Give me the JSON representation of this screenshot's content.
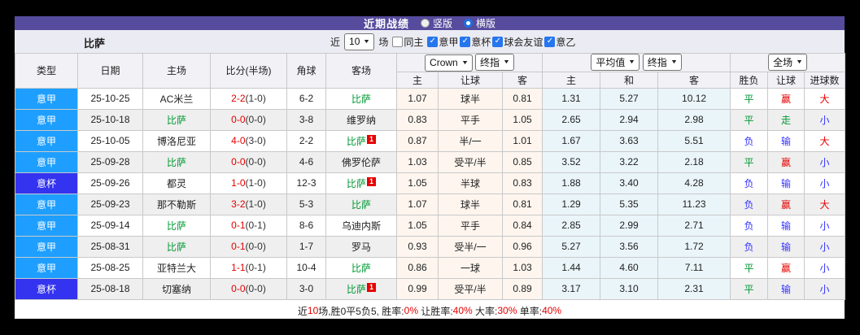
{
  "colors": {
    "header_purple": "#564c9d",
    "filter_bg": "#ebebf3",
    "header_bg": "#f1f1f6",
    "league_a": "#1e9fff",
    "league_b": "#3333f0",
    "win_red": "#e60000",
    "lose_blue": "#3333ff",
    "draw_green": "#009933",
    "check_blue": "#2676ee",
    "cream_bg": "#fdf5ee",
    "ltblue_bg": "#eaf5fa"
  },
  "title_bar": {
    "title": "近期战绩",
    "radio_vertical": "竖版",
    "radio_horizontal": "横版"
  },
  "filter_bar": {
    "team": "比萨",
    "recent_label": "近",
    "recent_count": "10",
    "games_label": "场",
    "same_home_label": "同主",
    "leagues": [
      "意甲",
      "意杯",
      "球会友谊",
      "意乙"
    ]
  },
  "table": {
    "headers": {
      "type": "类型",
      "date": "日期",
      "home": "主场",
      "score": "比分(半场)",
      "corner": "角球",
      "away": "客场",
      "crown_bookmaker": "Crown",
      "crown_stage": "终指",
      "crown_home": "主",
      "crown_line": "让球",
      "crown_away": "客",
      "avg_bookmaker": "平均值",
      "avg_stage": "终指",
      "avg_home": "主",
      "avg_draw": "和",
      "avg_away": "客",
      "result_scope": "全场",
      "win_loss": "胜负",
      "handicap": "让球",
      "goals": "进球数"
    },
    "rows": [
      {
        "league": "意甲",
        "league_class": "la",
        "date": "25-10-25",
        "home": "AC米兰",
        "home_is_focus": false,
        "score_ft": "2-2",
        "score_ht": "(1-0)",
        "corner": "6-2",
        "away": "比萨",
        "away_is_focus": true,
        "away_red_card": false,
        "crown": [
          "1.07",
          "球半",
          "0.81"
        ],
        "avg": [
          "1.31",
          "5.27",
          "10.12"
        ],
        "results": [
          {
            "t": "平",
            "c": "g"
          },
          {
            "t": "赢",
            "c": "r"
          },
          {
            "t": "大",
            "c": "r"
          }
        ]
      },
      {
        "league": "意甲",
        "league_class": "la",
        "date": "25-10-18",
        "home": "比萨",
        "home_is_focus": true,
        "score_ft": "0-0",
        "score_ht": "(0-0)",
        "corner": "3-8",
        "away": "维罗纳",
        "away_is_focus": false,
        "away_red_card": false,
        "crown": [
          "0.83",
          "平手",
          "1.05"
        ],
        "avg": [
          "2.65",
          "2.94",
          "2.98"
        ],
        "results": [
          {
            "t": "平",
            "c": "g"
          },
          {
            "t": "走",
            "c": "g"
          },
          {
            "t": "小",
            "c": "b"
          }
        ]
      },
      {
        "league": "意甲",
        "league_class": "la",
        "date": "25-10-05",
        "home": "博洛尼亚",
        "home_is_focus": false,
        "score_ft": "4-0",
        "score_ht": "(3-0)",
        "corner": "2-2",
        "away": "比萨",
        "away_is_focus": true,
        "away_red_card": true,
        "crown": [
          "0.87",
          "半/一",
          "1.01"
        ],
        "avg": [
          "1.67",
          "3.63",
          "5.51"
        ],
        "results": [
          {
            "t": "负",
            "c": "b"
          },
          {
            "t": "输",
            "c": "b"
          },
          {
            "t": "大",
            "c": "r"
          }
        ]
      },
      {
        "league": "意甲",
        "league_class": "la",
        "date": "25-09-28",
        "home": "比萨",
        "home_is_focus": true,
        "score_ft": "0-0",
        "score_ht": "(0-0)",
        "corner": "4-6",
        "away": "佛罗伦萨",
        "away_is_focus": false,
        "away_red_card": false,
        "crown": [
          "1.03",
          "受平/半",
          "0.85"
        ],
        "avg": [
          "3.52",
          "3.22",
          "2.18"
        ],
        "results": [
          {
            "t": "平",
            "c": "g"
          },
          {
            "t": "赢",
            "c": "r"
          },
          {
            "t": "小",
            "c": "b"
          }
        ]
      },
      {
        "league": "意杯",
        "league_class": "lb",
        "date": "25-09-26",
        "home": "都灵",
        "home_is_focus": false,
        "score_ft": "1-0",
        "score_ht": "(1-0)",
        "corner": "12-3",
        "away": "比萨",
        "away_is_focus": true,
        "away_red_card": true,
        "crown": [
          "1.05",
          "半球",
          "0.83"
        ],
        "avg": [
          "1.88",
          "3.40",
          "4.28"
        ],
        "results": [
          {
            "t": "负",
            "c": "b"
          },
          {
            "t": "输",
            "c": "b"
          },
          {
            "t": "小",
            "c": "b"
          }
        ]
      },
      {
        "league": "意甲",
        "league_class": "la",
        "date": "25-09-23",
        "home": "那不勒斯",
        "home_is_focus": false,
        "score_ft": "3-2",
        "score_ht": "(1-0)",
        "corner": "5-3",
        "away": "比萨",
        "away_is_focus": true,
        "away_red_card": false,
        "crown": [
          "1.07",
          "球半",
          "0.81"
        ],
        "avg": [
          "1.29",
          "5.35",
          "11.23"
        ],
        "results": [
          {
            "t": "负",
            "c": "b"
          },
          {
            "t": "赢",
            "c": "r"
          },
          {
            "t": "大",
            "c": "r"
          }
        ]
      },
      {
        "league": "意甲",
        "league_class": "la",
        "date": "25-09-14",
        "home": "比萨",
        "home_is_focus": true,
        "score_ft": "0-1",
        "score_ht": "(0-1)",
        "corner": "8-6",
        "away": "乌迪内斯",
        "away_is_focus": false,
        "away_red_card": false,
        "crown": [
          "1.05",
          "平手",
          "0.84"
        ],
        "avg": [
          "2.85",
          "2.99",
          "2.71"
        ],
        "results": [
          {
            "t": "负",
            "c": "b"
          },
          {
            "t": "输",
            "c": "b"
          },
          {
            "t": "小",
            "c": "b"
          }
        ]
      },
      {
        "league": "意甲",
        "league_class": "la",
        "date": "25-08-31",
        "home": "比萨",
        "home_is_focus": true,
        "score_ft": "0-1",
        "score_ht": "(0-0)",
        "corner": "1-7",
        "away": "罗马",
        "away_is_focus": false,
        "away_red_card": false,
        "crown": [
          "0.93",
          "受半/一",
          "0.96"
        ],
        "avg": [
          "5.27",
          "3.56",
          "1.72"
        ],
        "results": [
          {
            "t": "负",
            "c": "b"
          },
          {
            "t": "输",
            "c": "b"
          },
          {
            "t": "小",
            "c": "b"
          }
        ]
      },
      {
        "league": "意甲",
        "league_class": "la",
        "date": "25-08-25",
        "home": "亚特兰大",
        "home_is_focus": false,
        "score_ft": "1-1",
        "score_ht": "(0-1)",
        "corner": "10-4",
        "away": "比萨",
        "away_is_focus": true,
        "away_red_card": false,
        "crown": [
          "0.86",
          "一球",
          "1.03"
        ],
        "avg": [
          "1.44",
          "4.60",
          "7.11"
        ],
        "results": [
          {
            "t": "平",
            "c": "g"
          },
          {
            "t": "赢",
            "c": "r"
          },
          {
            "t": "小",
            "c": "b"
          }
        ]
      },
      {
        "league": "意杯",
        "league_class": "lb",
        "date": "25-08-18",
        "home": "切塞纳",
        "home_is_focus": false,
        "score_ft": "0-0",
        "score_ht": "(0-0)",
        "corner": "3-0",
        "away": "比萨",
        "away_is_focus": true,
        "away_red_card": true,
        "crown": [
          "0.99",
          "受平/半",
          "0.89"
        ],
        "avg": [
          "3.17",
          "3.10",
          "2.31"
        ],
        "results": [
          {
            "t": "平",
            "c": "g"
          },
          {
            "t": "输",
            "c": "b"
          },
          {
            "t": "小",
            "c": "b"
          }
        ]
      }
    ]
  },
  "footer": {
    "segments": [
      {
        "t": "近",
        "red": false
      },
      {
        "t": "10",
        "red": true
      },
      {
        "t": "场,胜0平5负5, 胜率:",
        "red": false
      },
      {
        "t": "0%",
        "red": true
      },
      {
        "t": " 让胜率:",
        "red": false
      },
      {
        "t": "40%",
        "red": true
      },
      {
        "t": " 大率:",
        "red": false
      },
      {
        "t": "30%",
        "red": true
      },
      {
        "t": " 单率:",
        "red": false
      },
      {
        "t": "40%",
        "red": true
      }
    ]
  }
}
